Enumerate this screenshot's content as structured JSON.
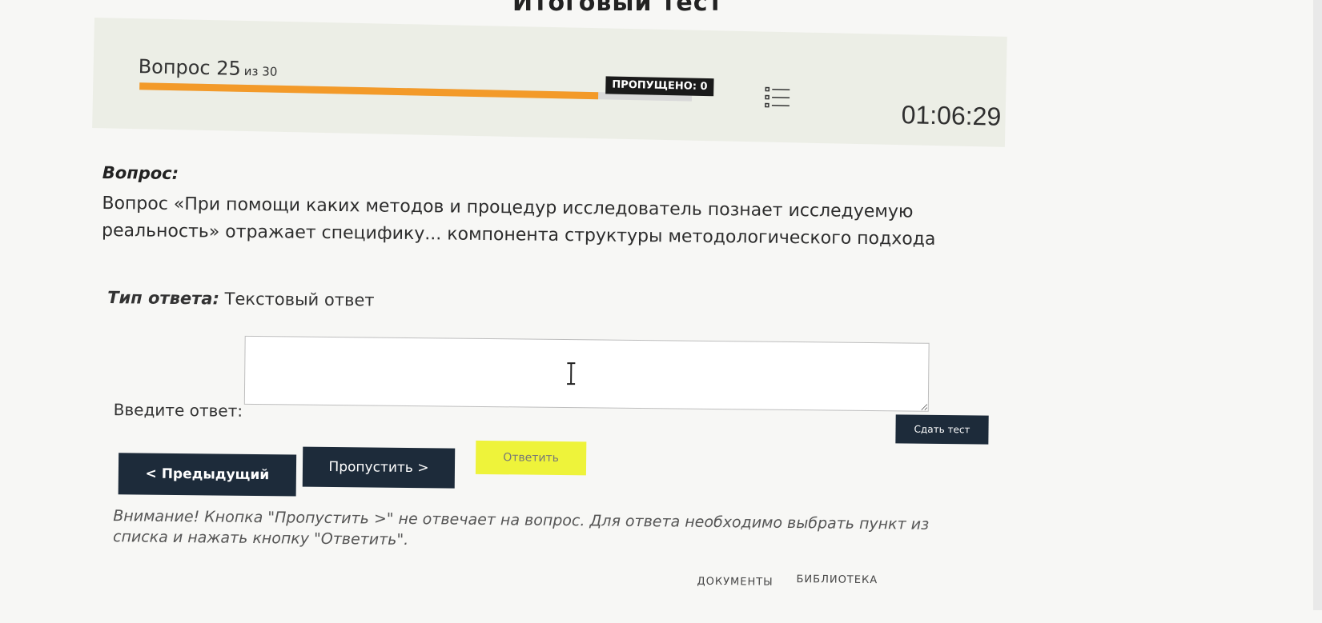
{
  "page": {
    "title": "Итоговый тест"
  },
  "header": {
    "question_word": "Вопрос 25",
    "question_of": "из 30",
    "progress_fraction": 0.83,
    "skipped_label": "ПРОПУЩЕНО: 0",
    "timer": "01:06:29",
    "list_icon": "question-list-icon"
  },
  "question": {
    "label": "Вопрос:",
    "text": "Вопрос «При помощи каких методов и процедур исследователь познает исследуемую реальность» отражает специфику... компонента структуры методологического подхода"
  },
  "answer_type": {
    "label": "Тип ответа:",
    "value": "Текстовый ответ"
  },
  "answer": {
    "label": "Введите ответ:",
    "value": "",
    "placeholder": ""
  },
  "buttons": {
    "prev": "< Предыдущий",
    "skip": "Пропустить >",
    "answer": "Ответить",
    "submit": "Сдать тест"
  },
  "note": "Внимание! Кнопка \"Пропустить >\" не отвечает на вопрос. Для ответа необходимо выбрать пункт из списка и нажать кнопку \"Ответить\".",
  "footer": {
    "documents": "ДОКУМЕНТЫ",
    "library": "БИБЛИОТЕКА"
  },
  "colors": {
    "progress": "#f39a29",
    "buttons": "#1d2b3a",
    "answer_button": "#eef33a"
  }
}
